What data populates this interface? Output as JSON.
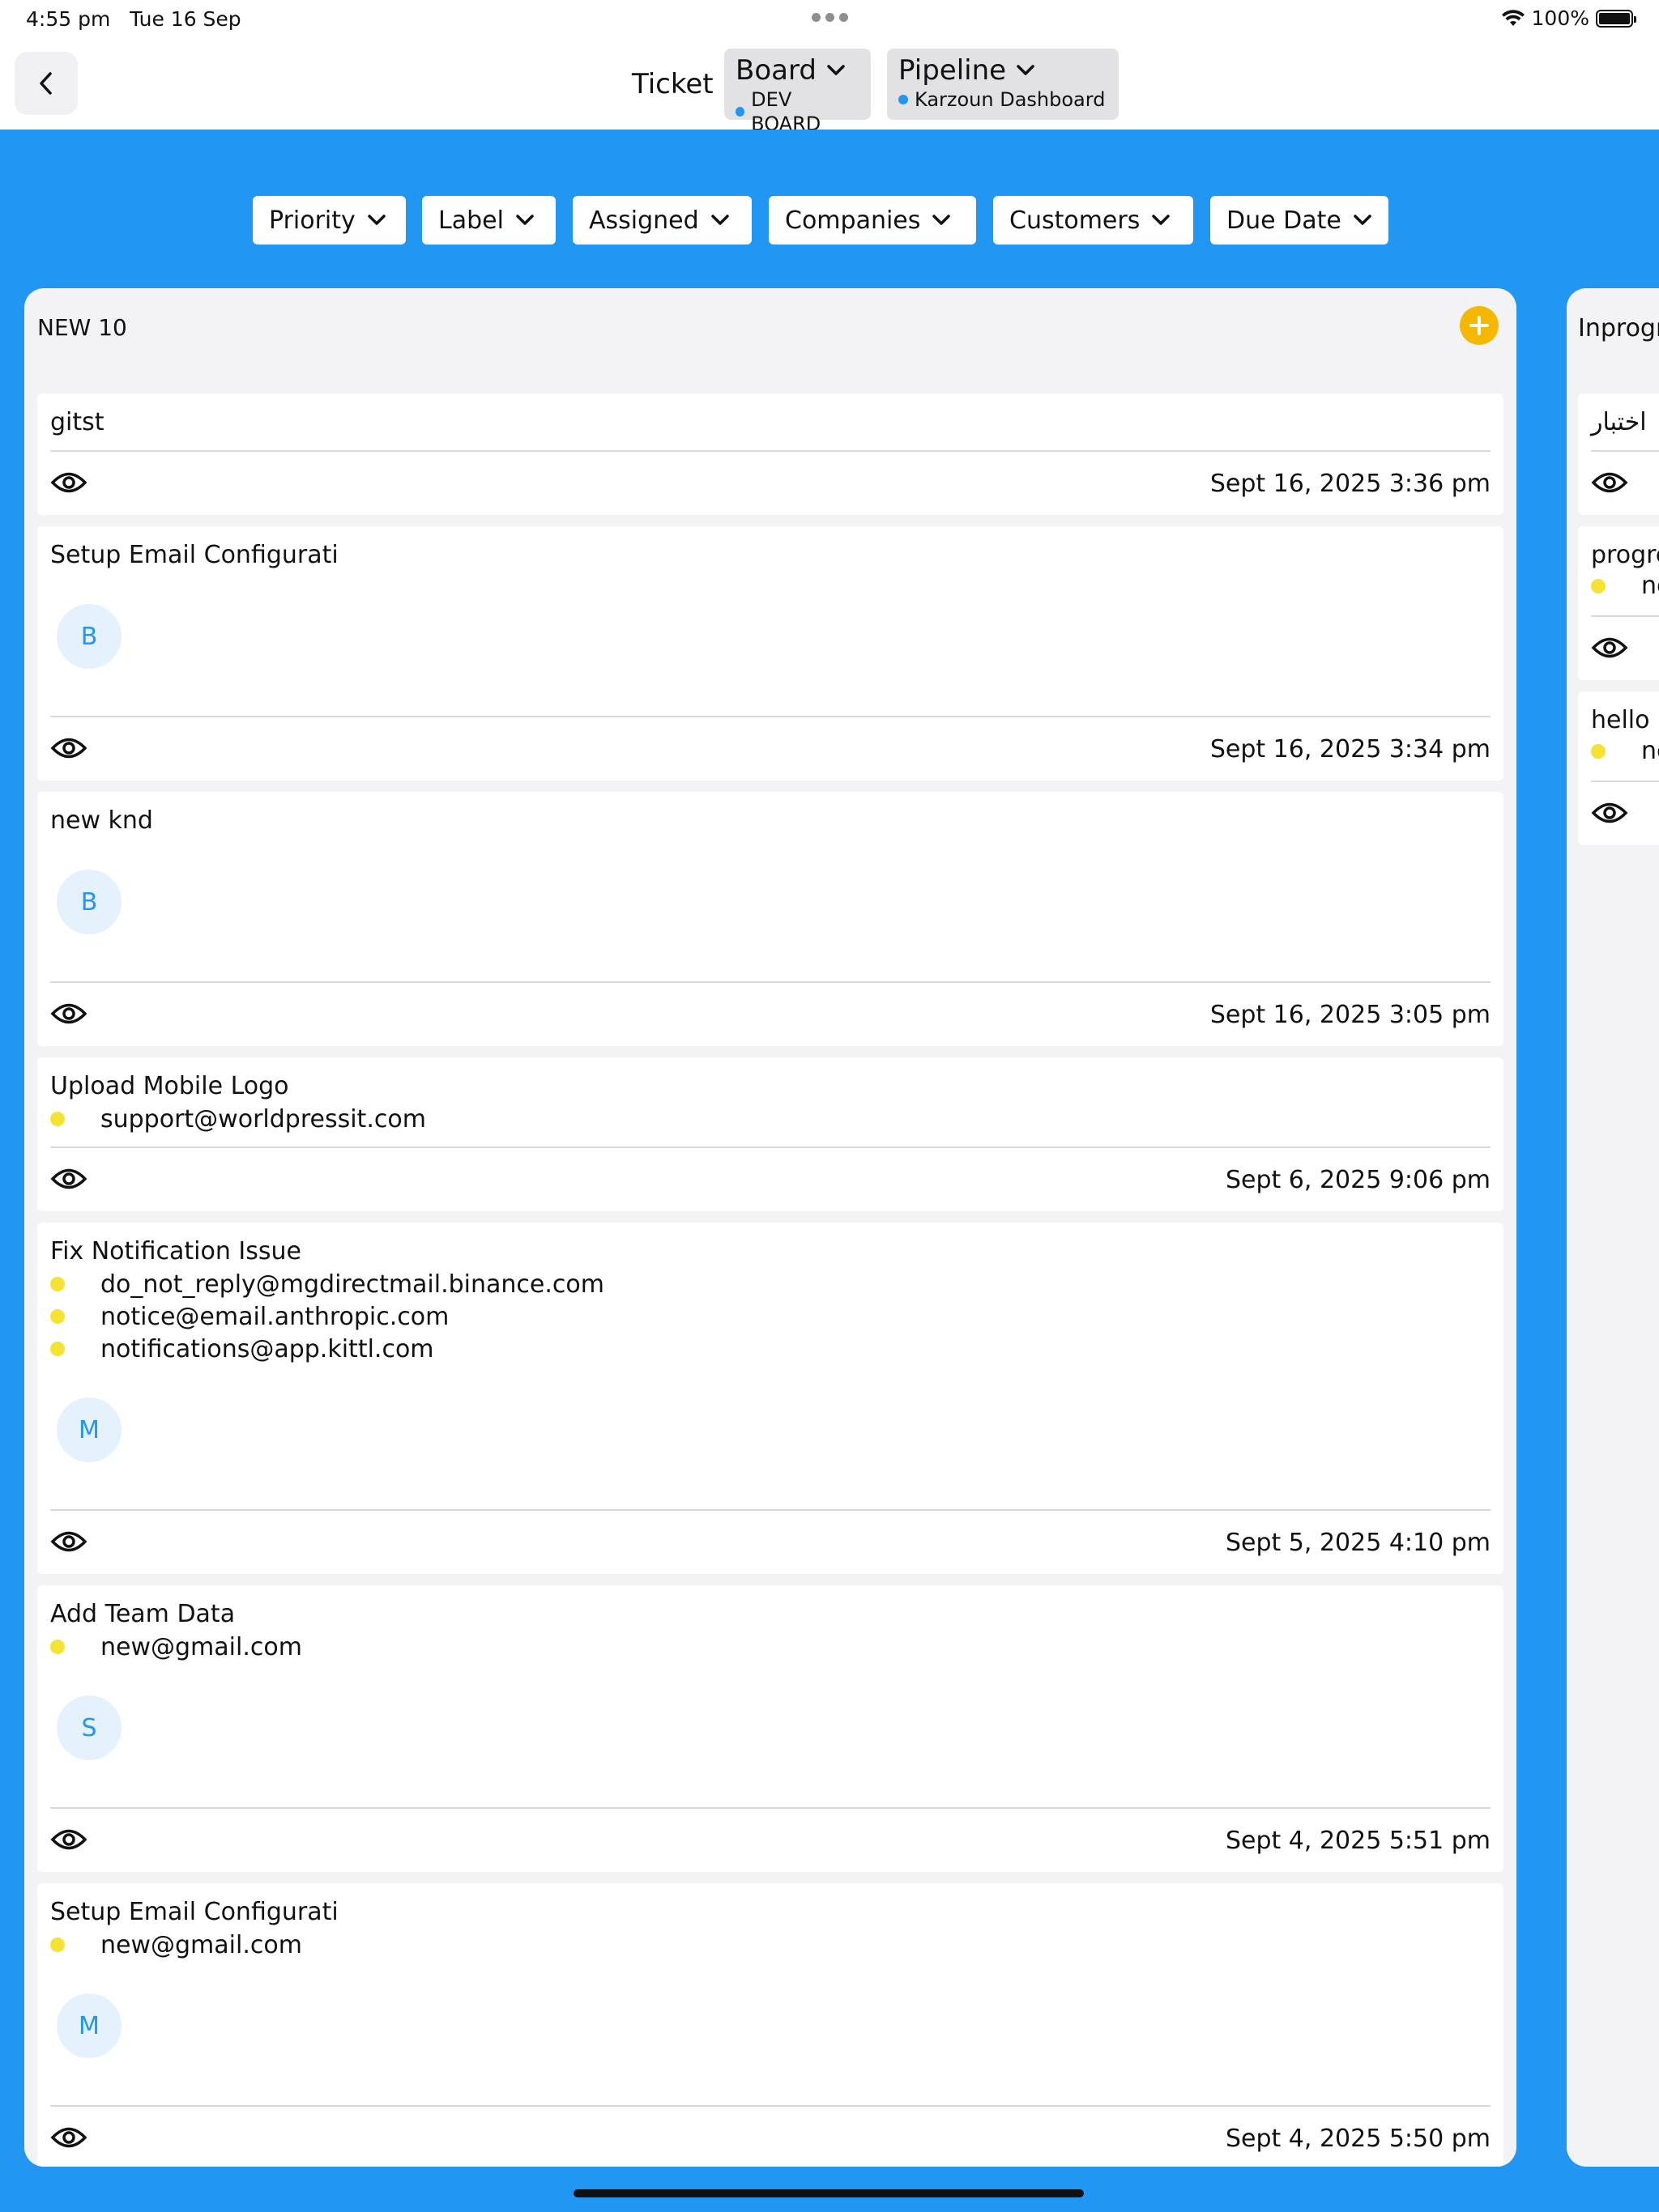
{
  "status_bar": {
    "time": "4:55 pm",
    "date": "Tue 16 Sep",
    "battery": "100%",
    "battery_level": 1.0
  },
  "header": {
    "title": "Ticket",
    "board": {
      "label": "Board",
      "value": "DEV BOARD"
    },
    "pipeline": {
      "label": "Pipeline",
      "value": "Karzoun Dashboard"
    }
  },
  "filters": [
    "Priority",
    "Label",
    "Assigned",
    "Companies",
    "Customers",
    "Due Date"
  ],
  "columns": [
    {
      "title": "NEW 10",
      "cards": [
        {
          "title": "gitst",
          "emails": [],
          "avatar": "",
          "date": "Sept 16, 2025 3:36 pm"
        },
        {
          "title": "Setup Email Configurati",
          "emails": [],
          "avatar": "B",
          "date": "Sept 16, 2025 3:34 pm"
        },
        {
          "title": "new knd",
          "emails": [],
          "avatar": "B",
          "date": "Sept 16, 2025 3:05 pm"
        },
        {
          "title": "Upload Mobile Logo",
          "emails": [
            "support@worldpressit.com"
          ],
          "avatar": "",
          "date": "Sept 6, 2025 9:06 pm"
        },
        {
          "title": "Fix Notification Issue",
          "emails": [
            "do_not_reply@mgdirectmail.binance.com",
            "notice@email.anthropic.com",
            "notifications@app.kittl.com"
          ],
          "avatar": "M",
          "date": "Sept 5, 2025 4:10 pm"
        },
        {
          "title": "Add Team Data",
          "emails": [
            "new@gmail.com"
          ],
          "avatar": "S",
          "date": "Sept 4, 2025 5:51 pm"
        },
        {
          "title": "Setup Email Configurati",
          "emails": [
            "new@gmail.com"
          ],
          "avatar": "M",
          "date": "Sept 4, 2025 5:50 pm"
        }
      ]
    },
    {
      "title": "Inprogr",
      "cards": [
        {
          "title": "اختبار",
          "email": ""
        },
        {
          "title": "progre",
          "email": "ne"
        },
        {
          "title": "hello l",
          "email": "ne"
        }
      ]
    }
  ],
  "colors": {
    "accent": "#2196f3",
    "add_button": "#f5b800",
    "email_dot": "#f6e233",
    "avatar_bg": "#e5f1fc"
  }
}
